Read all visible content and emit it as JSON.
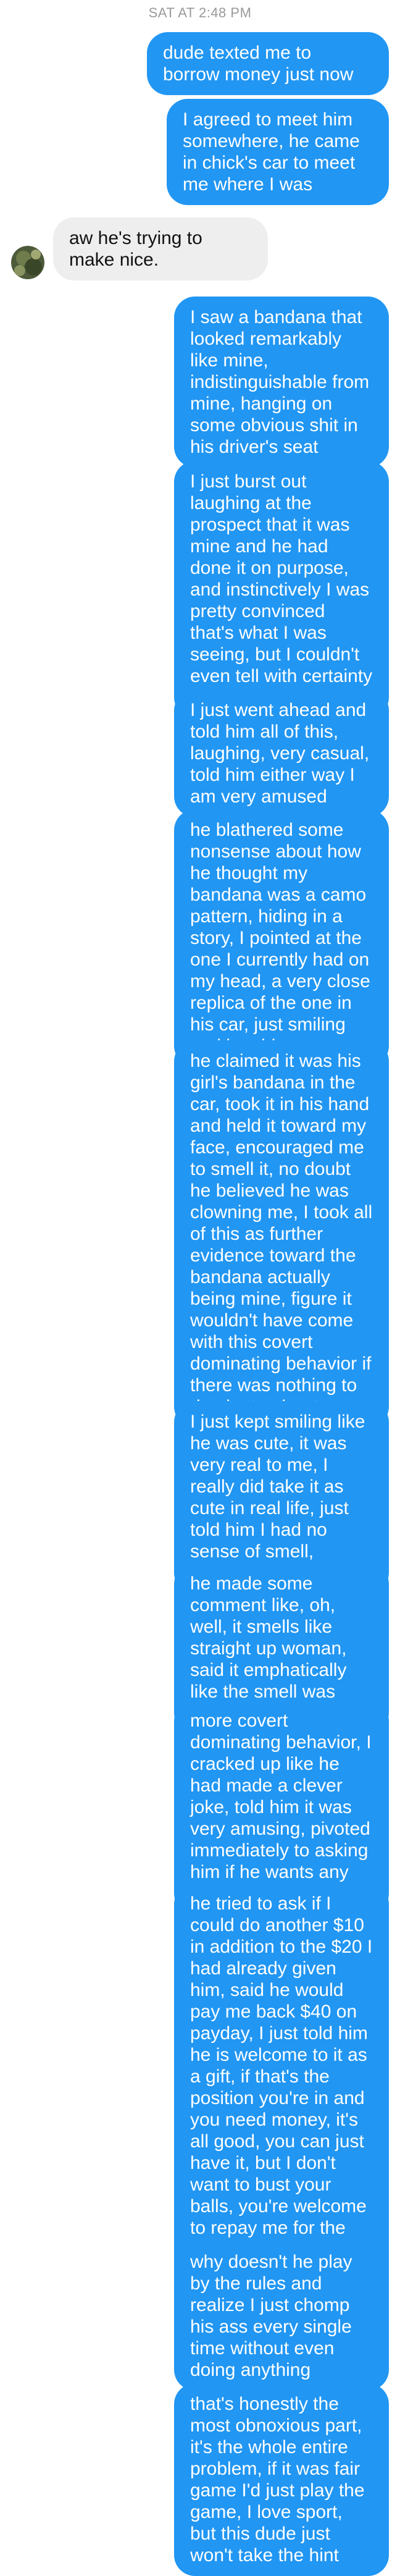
{
  "thread": {
    "timestamp": "SAT AT 2:48 PM",
    "messages": [
      {
        "side": "out",
        "text": "dude texted me to borrow money just now"
      },
      {
        "side": "out",
        "text": "I agreed to meet him somewhere, he came in chick's car to meet me where I was"
      },
      {
        "side": "in",
        "text": "aw he's trying to make nice."
      },
      {
        "side": "out",
        "text": "I saw a bandana that looked remarkably like mine, indistinguishable from mine, hanging on some obvious shit in his driver's seat"
      },
      {
        "side": "out",
        "text": "I just burst out laughing at the prospect that it was mine and he had done it on purpose, and instinctively I was pretty convinced that's what I was seeing, but I couldn't even tell with certainty that it was mine"
      },
      {
        "side": "out",
        "text": "I just went ahead and told him all of this, laughing, very casual, told him either way I am very amused"
      },
      {
        "side": "out",
        "text": "he blathered some nonsense about how he thought my bandana was a camo pattern, hiding in a story, I pointed at the one I currently had on my head, a very close replica of the one in his car, just smiling and laughing"
      },
      {
        "side": "out",
        "text": "he claimed it was his girl's bandana in the car, took it in his hand and held it toward my face, encouraged me to smell it, no doubt he believed he was clowning me, I took all of this as further evidence toward the bandana actually being mine, figure it wouldn't have come with this covert dominating behavior if there was nothing to dominate about"
      },
      {
        "side": "out",
        "text": "I just kept smiling like he was cute, it was very real to me, I really did take it as cute in real life, just told him I had no sense of smell, amused"
      },
      {
        "side": "out",
        "text": "he made some comment like, oh, well, it smells like straight up woman, said it emphatically like the smell was strong"
      },
      {
        "side": "out",
        "text": "more covert dominating behavior, I cracked up like he had made a clever joke, told him it was very amusing, pivoted immediately to asking him if he wants any more money"
      },
      {
        "side": "out",
        "text": "he tried to ask if I could do another $10 in addition to the $20 I had already given him, said he would pay me back $40 on payday, I just told him he is welcome to it as a gift, if that's the position you're in and you need money, it's all good, you can just have it, but I don't want to bust your balls, you're welcome to repay me for the sake of your own honor"
      },
      {
        "side": "out",
        "text": "why doesn't he play by the rules and realize I just chomp his ass every single time without even doing anything"
      },
      {
        "side": "out",
        "text": "that's honestly the most obnoxious part, it's the whole entire problem, if it was fair game I'd just play the game, I love sport, but this dude just won't take the hint"
      }
    ]
  }
}
